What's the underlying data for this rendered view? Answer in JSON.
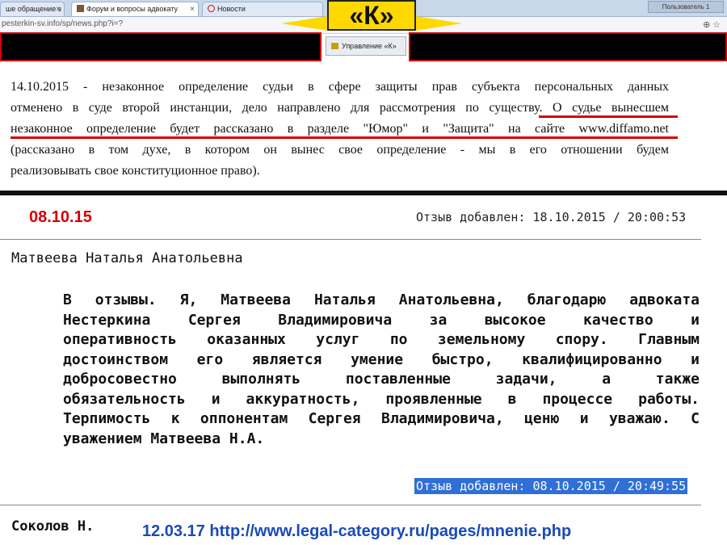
{
  "browser": {
    "tabs": [
      {
        "label": "ше обращение з"
      },
      {
        "label": "Форум и вопросы адвокату"
      },
      {
        "label": "Новости"
      }
    ],
    "user_label": "Пользователь 1",
    "url": "pesterkin-sv.info/sp/news.php?i=?",
    "bookmark_tab": "Управление «К»"
  },
  "logo": {
    "text": "«К»",
    "color": "#ffd800"
  },
  "notice": {
    "lines": [
      "14.10.2015 - незаконное определение судьи в сфере защиты прав субъекта персональных данных",
      "отменено в суде второй инстанции, дело направлено для рассмотрения по существу. О судье вынесшем",
      "незаконное определение будет рассказано в разделе \"Юмор\" и \"Защита\" на сайте www.diffamo.net",
      "(рассказано в том духе, в котором он вынес свое определение - мы в его отношении будем",
      "реализовывать свое конституционное право)."
    ]
  },
  "review1": {
    "date_tag": "08.10.15",
    "added": "Отзыв добавлен: 18.10.2015 / 20:00:53",
    "author": "Матвеева Наталья Анатольевна",
    "lines": [
      "В отзывы. Я, Матвеева Наталья Анатольевна, благодарю адвоката",
      "Нестеркина Сергея Владимировича за высокое качество и",
      "оперативность оказанных услуг по земельному спору. Главным",
      "достоинством его является умение быстро, квалифицированно и",
      "добросовестно выполнять поставленные задачи, а также",
      "обязательность и аккуратность, проявленные в процессе работы.",
      "Терпимость к оппонентам Сергея Владимировича, ценю и уважаю. С",
      "уважением Матвеева Н.А."
    ],
    "added_highlighted": "Отзыв добавлен: 08.10.2015 / 20:49:55"
  },
  "review2": {
    "author": "Соколов Н."
  },
  "source_caption": "12.03.17 http://www.legal-category.ru/pages/mnenie.php",
  "colors": {
    "accent_red": "#d40000",
    "highlight_blue": "#2f6fd6",
    "caption_blue": "#1a4ab8"
  }
}
